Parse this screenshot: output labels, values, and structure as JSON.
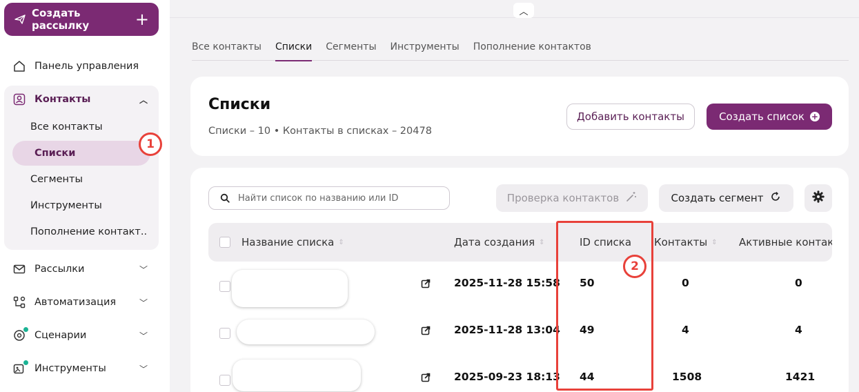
{
  "sidebar": {
    "create_button": "Создать рассылку",
    "items": {
      "dashboard": "Панель управления",
      "contacts": "Контакты",
      "mailings": "Рассылки",
      "automation": "Автоматизация",
      "scenarios": "Сценарии",
      "tools": "Инструменты"
    },
    "contacts_sub": {
      "all": "Все контакты",
      "lists": "Списки",
      "segments": "Сегменты",
      "tools": "Инструменты",
      "refill": "Пополнение контакт..."
    }
  },
  "annotations": {
    "badge1": "1",
    "badge2": "2"
  },
  "tabs": [
    "Все контакты",
    "Списки",
    "Сегменты",
    "Инструменты",
    "Пополнение контактов"
  ],
  "header": {
    "title": "Списки",
    "subtitle": "Списки – 10 • Контакты в списках – 20478",
    "add_contacts": "Добавить контакты",
    "create_list": "Создать список"
  },
  "toolbar": {
    "search_placeholder": "Найти список по названию или ID",
    "check_contacts": "Проверка контактов",
    "create_segment": "Создать сегмент"
  },
  "table": {
    "columns": {
      "name": "Название списка",
      "date": "Дата создания",
      "id": "ID списка",
      "contacts": "Контакты",
      "active": "Активные контак"
    },
    "rows": [
      {
        "date": "2025-11-28 15:58",
        "id": "50",
        "contacts": "0",
        "active": "0"
      },
      {
        "date": "2025-11-28 13:04",
        "id": "49",
        "contacts": "4",
        "active": "4"
      },
      {
        "date": "2025-09-23 18:13",
        "id": "44",
        "contacts": "1508",
        "active": "1421"
      }
    ]
  },
  "colors": {
    "brand": "#7b2a73",
    "accent_light": "#e8d6e6",
    "annotation_red": "#e8413a",
    "status_dot": "#1ab394"
  },
  "icons": [
    "mail-plane-icon",
    "plus-icon",
    "home-icon",
    "user-icon",
    "chevron-up-icon",
    "envelope-icon",
    "automation-icon",
    "scenario-icon",
    "tools-icon",
    "chevron-down-icon",
    "search-icon",
    "magic-wand-icon",
    "refresh-icon",
    "gear-icon",
    "external-link-icon"
  ]
}
